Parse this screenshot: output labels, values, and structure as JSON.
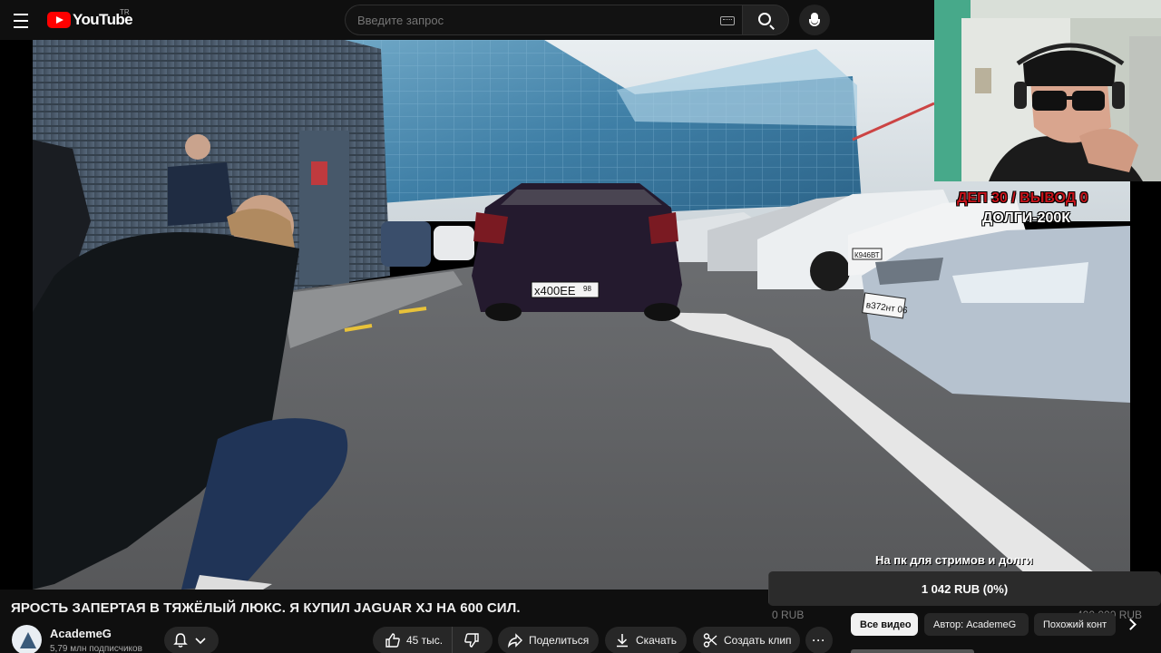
{
  "header": {
    "logo_text": "YouTube",
    "region": "TR",
    "search_placeholder": "Введите запрос",
    "icons": [
      "menu-icon",
      "keyboard-icon",
      "search-icon",
      "mic-icon"
    ]
  },
  "video": {
    "plate_main": "х400ЕЕ",
    "plate_region": "98",
    "plate_car_right": "в372нт 06",
    "plate_car_mid": "К946ВТ"
  },
  "overlay": {
    "line1": "ДЕП 30 / ВЫВОД 0",
    "line2": "ДОЛГИ-200К",
    "line1_color": "#c8141b"
  },
  "donation": {
    "title": "На пк для стримов и долги",
    "amount_text": "1 042 RUB (0%)",
    "min_label": "0 RUB",
    "max_label": "400 000 RUB",
    "progress": 0.0026
  },
  "info": {
    "title": "ЯРОСТЬ ЗАПЕРТАЯ В ТЯЖЁЛЫЙ ЛЮКС. Я КУПИЛ JAGUAR XJ НА 600 СИЛ.",
    "channel": "AcademeG",
    "subscribers": "5,79 млн подписчиков",
    "likes": "45 тыс.",
    "share": "Поделиться",
    "download": "Скачать",
    "clip": "Создать клип",
    "more": "···"
  },
  "chips": {
    "all": "Все видео",
    "author": "Автор: AcademeG",
    "similar": "Похожий конт"
  }
}
